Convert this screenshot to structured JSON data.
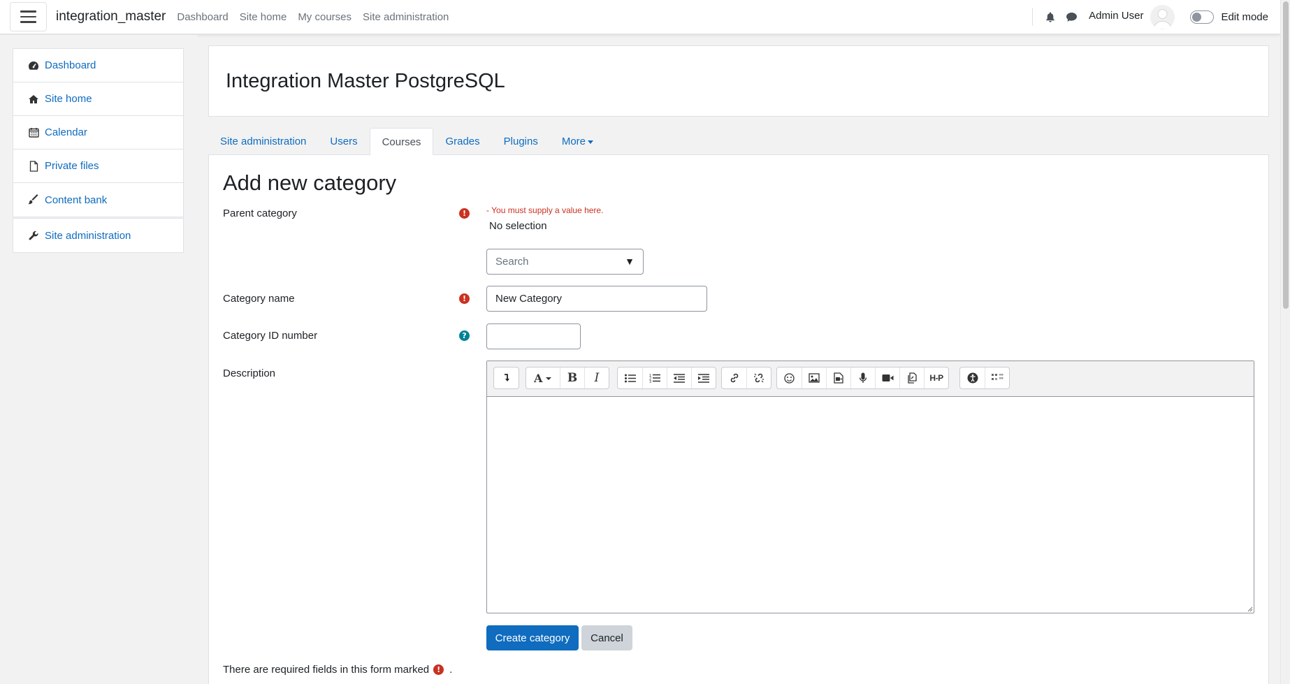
{
  "navbar": {
    "brand": "integration_master",
    "links": [
      "Dashboard",
      "Site home",
      "My courses",
      "Site administration"
    ],
    "user_name": "Admin User",
    "edit_mode_label": "Edit mode"
  },
  "drawer": {
    "items": [
      "Dashboard",
      "Site home",
      "Calendar",
      "Private files",
      "Content bank"
    ],
    "admin_item": "Site administration"
  },
  "header": {
    "title": "Integration Master PostgreSQL"
  },
  "tabs": [
    "Site administration",
    "Users",
    "Courses",
    "Grades",
    "Plugins",
    "More"
  ],
  "active_tab": "Courses",
  "form": {
    "title": "Add new category",
    "parent_label": "Parent category",
    "parent_error": "- You must supply a value here.",
    "parent_selection": "No selection",
    "search_placeholder": "Search",
    "name_label": "Category name",
    "name_value": "New Category",
    "idnumber_label": "Category ID number",
    "idnumber_value": "",
    "description_label": "Description",
    "submit_label": "Create category",
    "cancel_label": "Cancel",
    "required_note": "There are required fields in this form marked",
    "required_note_end": "."
  },
  "editor_toolbar_icons": [
    "collapse-icon",
    "font-style-icon",
    "bold-icon",
    "italic-icon",
    "unordered-list-icon",
    "ordered-list-icon",
    "outdent-icon",
    "indent-icon",
    "link-icon",
    "unlink-icon",
    "emoji-icon",
    "image-icon",
    "media-icon",
    "record-audio-icon",
    "record-video-icon",
    "manage-files-icon",
    "h5p-icon",
    "accessibility-checker-icon",
    "screenreader-helper-icon"
  ],
  "colors": {
    "link": "#0f6cbf",
    "required": "#ca3120",
    "help": "#008196",
    "primary_button": "#0f6cbf"
  }
}
